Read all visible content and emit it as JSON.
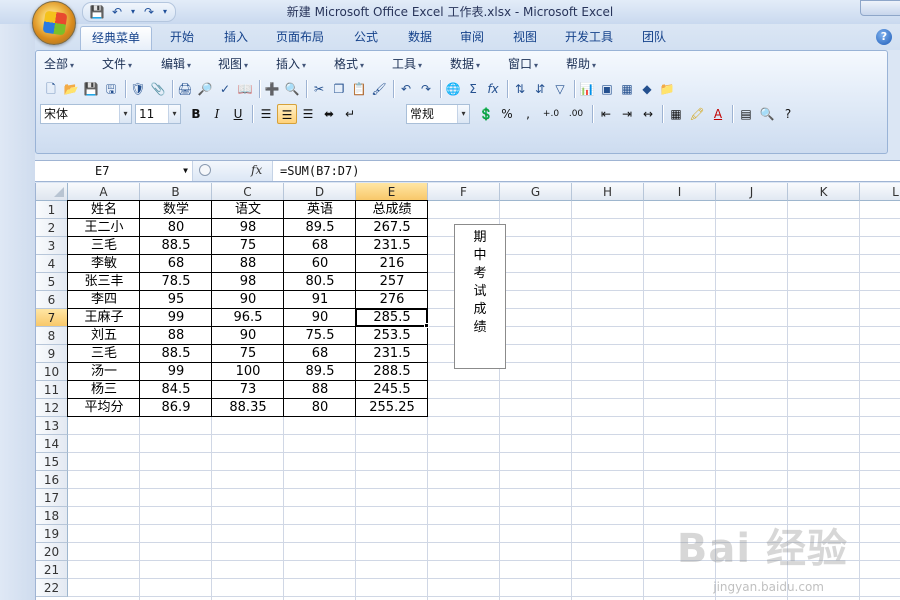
{
  "window": {
    "title": "新建 Microsoft Office Excel 工作表.xlsx - Microsoft Excel"
  },
  "quick_access": {
    "save_icon": "save-icon",
    "undo_icon": "undo-icon",
    "redo_icon": "redo-icon"
  },
  "ribbon_tabs": [
    {
      "label": "经典菜单",
      "active": true
    },
    {
      "label": "开始"
    },
    {
      "label": "插入"
    },
    {
      "label": "页面布局"
    },
    {
      "label": "公式"
    },
    {
      "label": "数据"
    },
    {
      "label": "审阅"
    },
    {
      "label": "视图"
    },
    {
      "label": "开发工具"
    },
    {
      "label": "团队"
    }
  ],
  "classic_menu": [
    "全部",
    "文件",
    "编辑",
    "视图",
    "插入",
    "格式",
    "工具",
    "数据",
    "窗口",
    "帮助"
  ],
  "format_bar": {
    "font": "宋体",
    "size": "11",
    "bold": "B",
    "italic": "I",
    "underline": "U",
    "number_format": "常规",
    "percent": "%",
    "comma": ",",
    "increase_decimal": "+.0",
    "decrease_decimal": ".00"
  },
  "formula_bar": {
    "cell_ref": "E7",
    "formula": "=SUM(B7:D7)"
  },
  "sheet": {
    "columns": [
      "A",
      "B",
      "C",
      "D",
      "E",
      "F",
      "G",
      "H",
      "I",
      "J",
      "K",
      "L"
    ],
    "selected_column": "E",
    "selected_row": 7,
    "rows": [
      "1",
      "2",
      "3",
      "4",
      "5",
      "6",
      "7",
      "8",
      "9",
      "10",
      "11",
      "12",
      "13",
      "14",
      "15",
      "16",
      "17",
      "18",
      "19",
      "20",
      "21",
      "22"
    ],
    "table": [
      [
        "姓名",
        "数学",
        "语文",
        "英语",
        "总成绩"
      ],
      [
        "王二小",
        "80",
        "98",
        "89.5",
        "267.5"
      ],
      [
        "三毛",
        "88.5",
        "75",
        "68",
        "231.5"
      ],
      [
        "李敏",
        "68",
        "88",
        "60",
        "216"
      ],
      [
        "张三丰",
        "78.5",
        "98",
        "80.5",
        "257"
      ],
      [
        "李四",
        "95",
        "90",
        "91",
        "276"
      ],
      [
        "王麻子",
        "99",
        "96.5",
        "90",
        "285.5"
      ],
      [
        "刘五",
        "88",
        "90",
        "75.5",
        "253.5"
      ],
      [
        "三毛",
        "88.5",
        "75",
        "68",
        "231.5"
      ],
      [
        "汤一",
        "99",
        "100",
        "89.5",
        "288.5"
      ],
      [
        "杨三",
        "84.5",
        "73",
        "88",
        "245.5"
      ],
      [
        "平均分",
        "86.9",
        "88.35",
        "80",
        "255.25"
      ]
    ],
    "text_box": [
      "期",
      "中",
      "考",
      "试",
      "成",
      "绩"
    ]
  },
  "watermark": {
    "brand": "Bai 经验",
    "url": "jingyan.baidu.com"
  }
}
